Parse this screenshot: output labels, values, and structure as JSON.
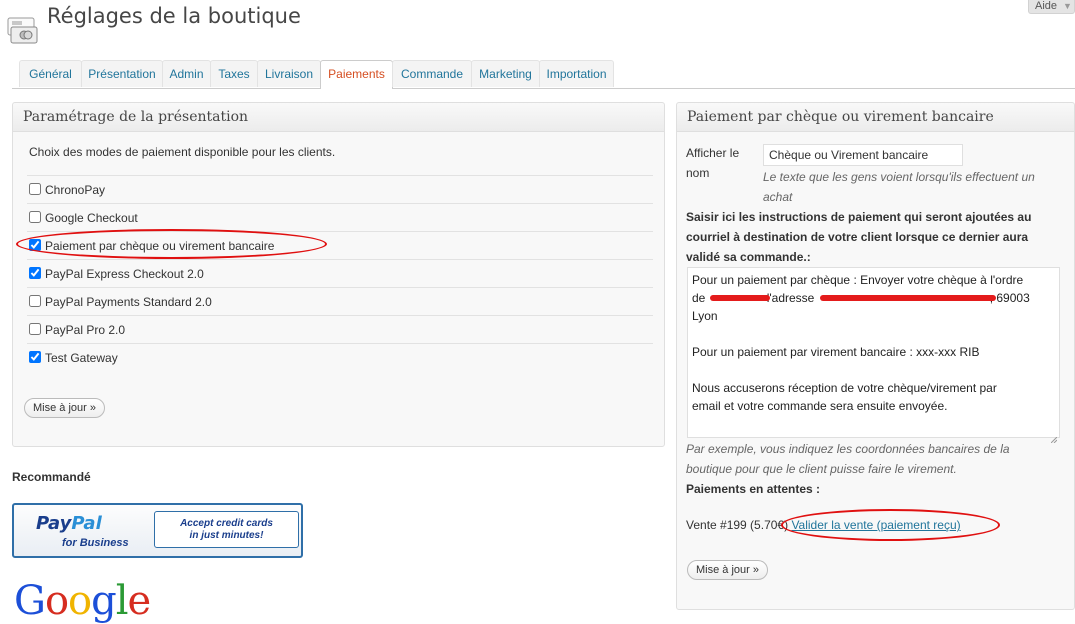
{
  "header": {
    "title": "Réglages de la boutique",
    "help_label": "Aide"
  },
  "tabs": [
    {
      "label": "Général",
      "active": false
    },
    {
      "label": "Présentation",
      "active": false
    },
    {
      "label": "Admin",
      "active": false
    },
    {
      "label": "Taxes",
      "active": false
    },
    {
      "label": "Livraison",
      "active": false
    },
    {
      "label": "Paiements",
      "active": true
    },
    {
      "label": "Commande",
      "active": false
    },
    {
      "label": "Marketing",
      "active": false
    },
    {
      "label": "Importation",
      "active": false
    }
  ],
  "left_panel": {
    "title": "Paramétrage de la présentation",
    "intro": "Choix des modes de paiement disponible pour les clients.",
    "options": [
      {
        "label": "ChronoPay",
        "checked": false
      },
      {
        "label": "Google Checkout",
        "checked": false
      },
      {
        "label": "Paiement par chèque ou virement bancaire",
        "checked": true
      },
      {
        "label": "PayPal Express Checkout 2.0",
        "checked": true
      },
      {
        "label": "PayPal Payments Standard 2.0",
        "checked": false
      },
      {
        "label": "PayPal Pro 2.0",
        "checked": false
      },
      {
        "label": "Test Gateway",
        "checked": true
      }
    ],
    "update_button": "Mise à jour »"
  },
  "right_panel": {
    "title": "Paiement par chèque ou virement bancaire",
    "display_name_label_1": "Afficher le",
    "display_name_label_2": "nom",
    "display_name_value": "Chèque ou Virement bancaire",
    "display_name_hint_1": "Le texte que les gens voient lorsqu'ils effectuent un",
    "display_name_hint_2": "achat",
    "instructions_label_1": "Saisir ici les instructions de paiement qui seront ajoutées au",
    "instructions_label_2": "courriel à destination de votre client lorsque ce dernier aura",
    "instructions_label_3": "validé sa commande.:",
    "instructions_line_1": "Pour un paiement par chèque : Envoyer votre chèque à l'ordre",
    "instructions_line_2a": "de",
    "instructions_line_2b": "l'adresse",
    "instructions_line_2c": ", 69003",
    "instructions_line_3": "Lyon",
    "instructions_line_4": "Pour un paiement par virement bancaire : xxx-xxx RIB",
    "instructions_line_5": "Nous accuserons réception de votre chèque/virement par",
    "instructions_line_6": "email et votre commande sera ensuite envoyée.",
    "example_hint_1": "Par exemple, vous indiquez les coordonnées bancaires de la",
    "example_hint_2": "boutique pour que le client puisse faire le virement.",
    "pending_label": "Paiements en attentes :",
    "pending_sale": "Vente #199 (5.70€)",
    "validate_link": "Valider la vente (paiement reçu)",
    "update_button": "Mise à jour »"
  },
  "recommended": {
    "title": "Recommandé",
    "paypal_logo_pay": "Pay",
    "paypal_logo_pal": "Pal",
    "paypal_sub": "for Business",
    "paypal_tagline_1": "Accept credit cards",
    "paypal_tagline_2": "in just minutes!",
    "google_logo": "Google"
  },
  "colors": {
    "link": "#21759b",
    "active_tab": "#d54e21",
    "annotation_red": "#e01010"
  }
}
